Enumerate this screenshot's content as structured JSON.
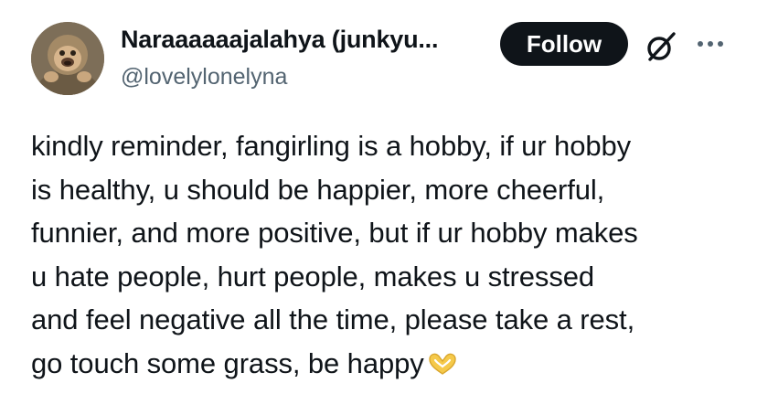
{
  "author": {
    "display_name": "Naraaaaaajalahya (junkyu...",
    "handle": "@lovelylonelyna",
    "avatar_icon": "monkey-avatar"
  },
  "actions": {
    "follow_label": "Follow",
    "grok_icon": "grok-icon",
    "more_icon": "more-icon"
  },
  "tweet": {
    "lines": [
      "kindly reminder, fangirling is a hobby, if ur hobby",
      "is healthy, u should be happier, more cheerful,",
      "funnier, and more positive, but if ur hobby makes",
      "u hate people, hurt people, makes u stressed",
      "and feel negative all the time, please take a rest,",
      "go touch some grass, be happy"
    ],
    "emoji": "heart-hands",
    "emoji_color": "#f5c94a"
  },
  "colors": {
    "text": "#0f1419",
    "secondary": "#536471",
    "button_bg": "#0f1419",
    "button_text": "#ffffff"
  }
}
